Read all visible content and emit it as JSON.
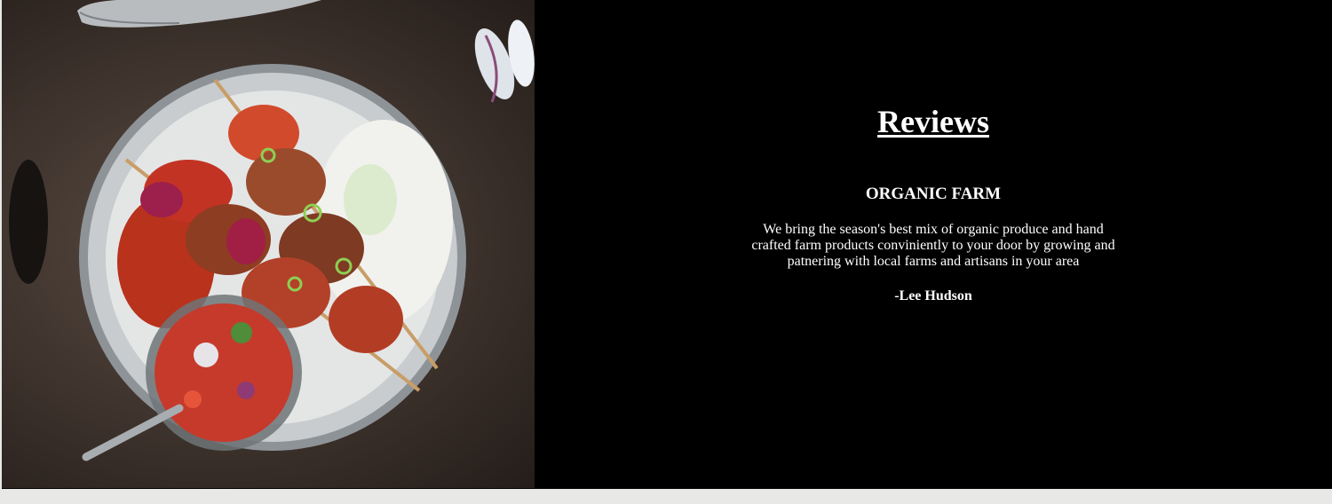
{
  "reviews": {
    "title": "Reviews",
    "heading": "ORGANIC FARM",
    "text": "We bring the season's best mix of organic produce and hand crafted farm products conviniently to your door by growing and patnering with local farms and artisans in your area",
    "author": "-Lee Hudson"
  },
  "image": {
    "subject": "food-photo"
  },
  "colors": {
    "background": "#000000",
    "text": "#ffffff",
    "footer_strip": "#e8e8e6"
  }
}
